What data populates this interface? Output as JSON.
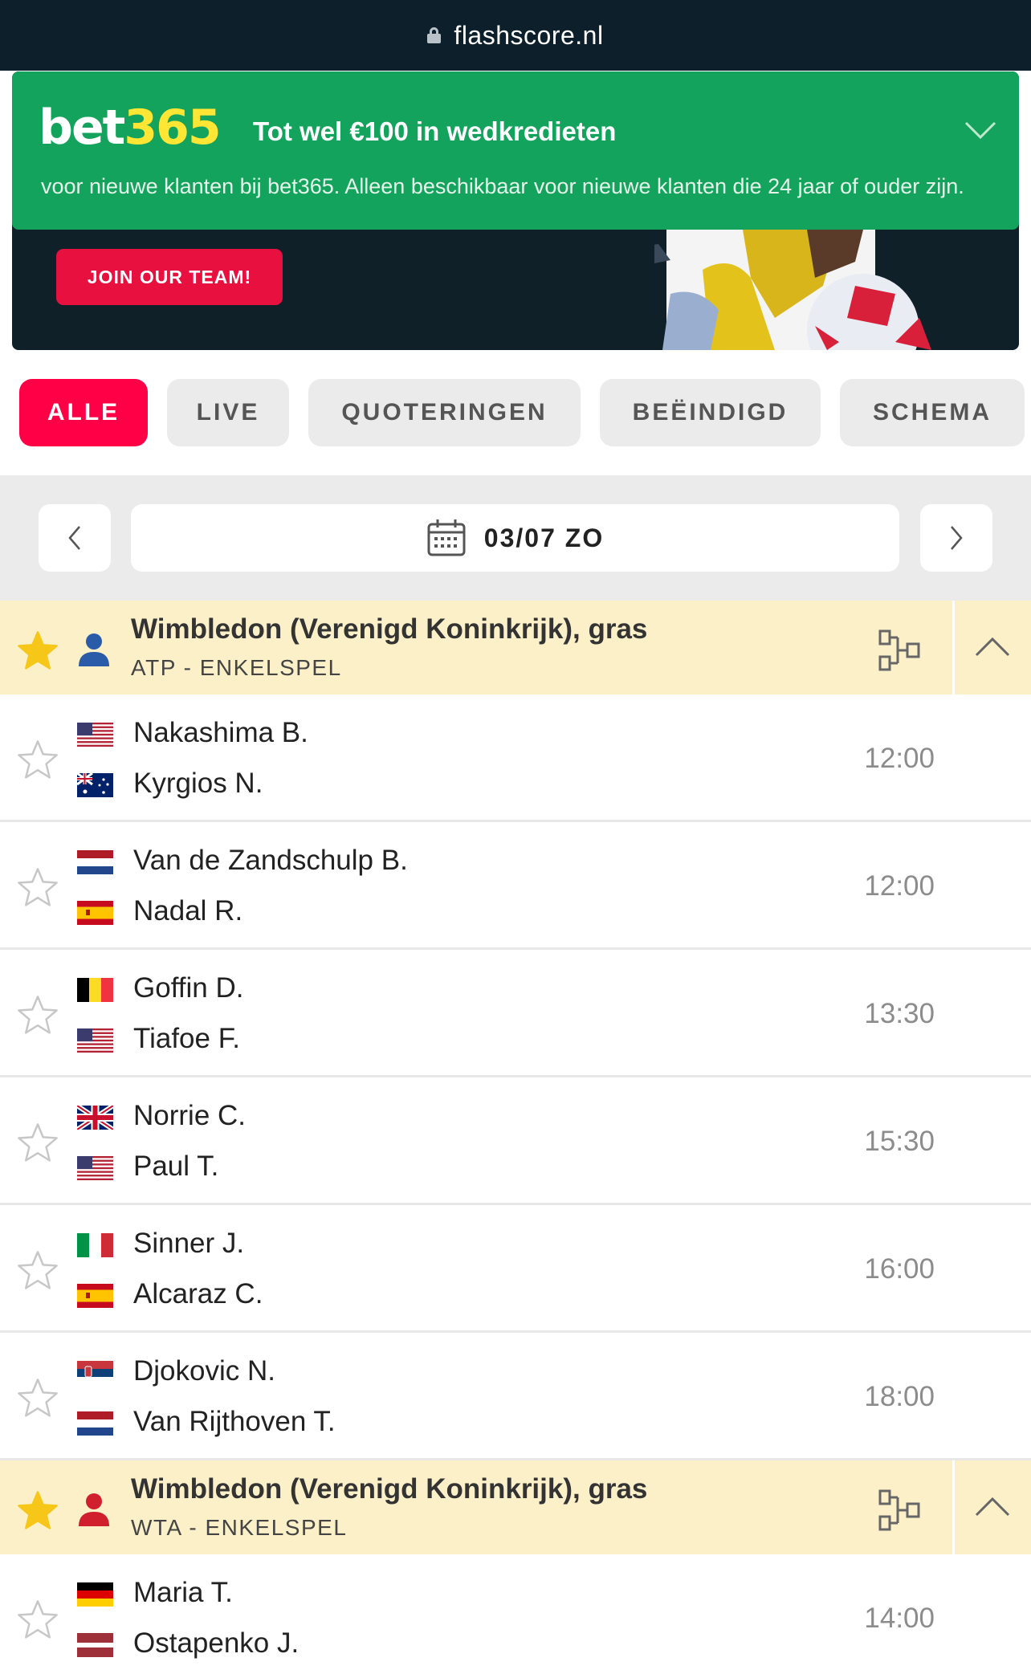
{
  "browser": {
    "url": "flashscore.nl",
    "lock_icon": "lock-icon"
  },
  "ad": {
    "logo_white": "bet",
    "logo_yellow": "365",
    "headline": "Tot wel €100 in wedkredieten",
    "subtext": "voor nieuwe klanten bij bet365. Alleen beschikbaar voor nieuwe klanten die 24 jaar of ouder zijn.",
    "join_label": "JOIN OUR TEAM!",
    "colors": {
      "green": "#14a35c",
      "yellow": "#ffe534",
      "join": "#e8103f"
    }
  },
  "filters": [
    {
      "label": "ALLE",
      "active": true
    },
    {
      "label": "LIVE",
      "active": false
    },
    {
      "label": "QUOTERINGEN",
      "active": false
    },
    {
      "label": "BEËINDIGD",
      "active": false
    },
    {
      "label": "SCHEMA",
      "active": false
    }
  ],
  "date": {
    "label": "03/07 ZO",
    "prev_icon": "chevron-left-icon",
    "next_icon": "chevron-right-icon"
  },
  "leagues": [
    {
      "title": "Wimbledon (Verenigd Koninkrijk), gras",
      "subtitle": "ATP - ENKELSPEL",
      "favorite": true,
      "person_color": "#2a5ba8",
      "matches": [
        {
          "home": "Nakashima B.",
          "home_flag": "us",
          "away": "Kyrgios N.",
          "away_flag": "au",
          "time": "12:00"
        },
        {
          "home": "Van de Zandschulp B.",
          "home_flag": "nl",
          "away": "Nadal R.",
          "away_flag": "es",
          "time": "12:00"
        },
        {
          "home": "Goffin D.",
          "home_flag": "be",
          "away": "Tiafoe F.",
          "away_flag": "us",
          "time": "13:30"
        },
        {
          "home": "Norrie C.",
          "home_flag": "gb",
          "away": "Paul T.",
          "away_flag": "us",
          "time": "15:30"
        },
        {
          "home": "Sinner J.",
          "home_flag": "it",
          "away": "Alcaraz C.",
          "away_flag": "es",
          "time": "16:00"
        },
        {
          "home": "Djokovic N.",
          "home_flag": "rs",
          "away": "Van Rijthoven T.",
          "away_flag": "nl",
          "time": "18:00"
        }
      ]
    },
    {
      "title": "Wimbledon (Verenigd Koninkrijk), gras",
      "subtitle": "WTA - ENKELSPEL",
      "favorite": true,
      "person_color": "#d0202e",
      "matches": [
        {
          "home": "Maria T.",
          "home_flag": "de",
          "away": "Ostapenko J.",
          "away_flag": "lv",
          "time": "14:00"
        }
      ]
    }
  ]
}
